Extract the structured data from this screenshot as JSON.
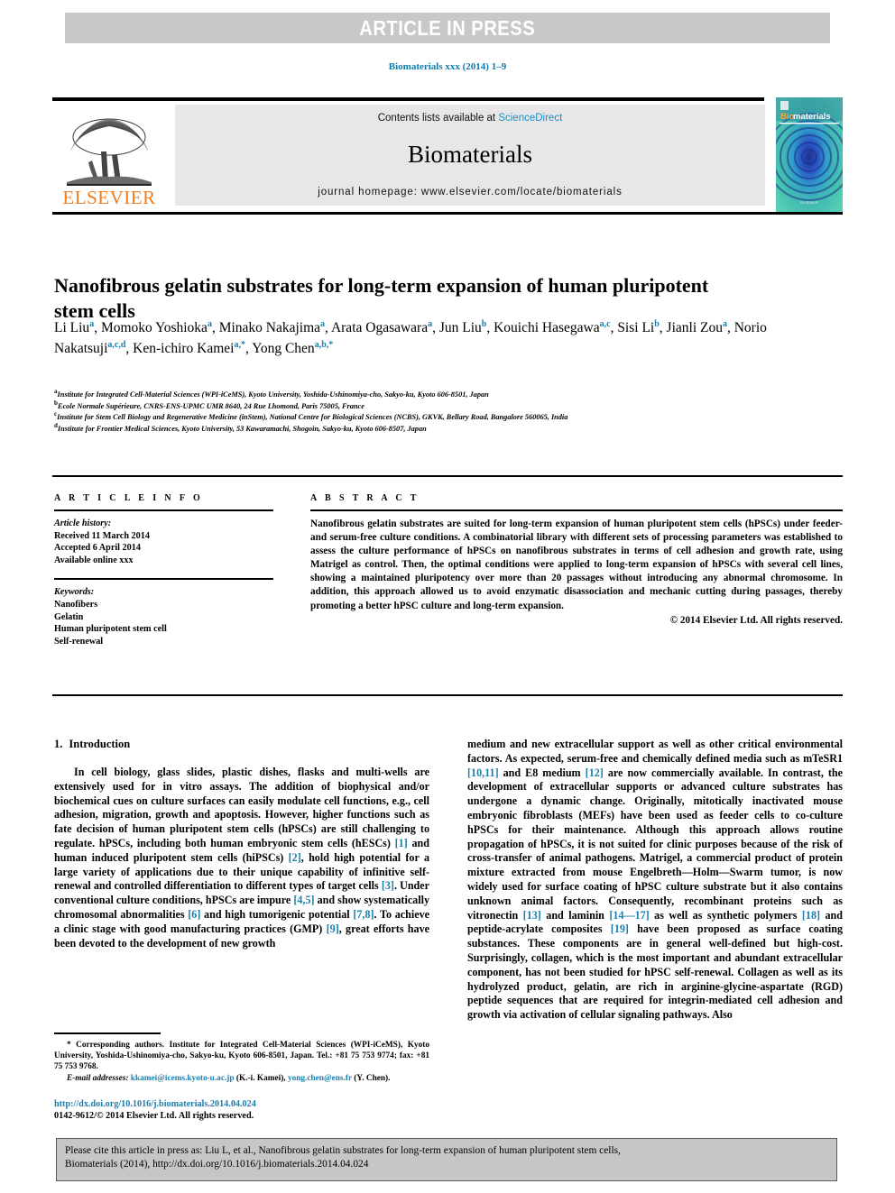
{
  "banner": {
    "text": "ARTICLE IN PRESS"
  },
  "journal_ref": "Biomaterials xxx (2014) 1–9",
  "header": {
    "contents_prefix": "Contents lists available at ",
    "contents_link": "ScienceDirect",
    "journal_title": "Biomaterials",
    "homepage": "journal homepage: www.elsevier.com/locate/biomaterials",
    "publisher_logo": "elsevier-tree-logo",
    "publisher_name": "ELSEVIER",
    "cover_label": "Biomaterials",
    "accent_link_color": "#1a8fc4",
    "elsevier_orange": "#f07d20",
    "banner_gray": "#c8c8c8"
  },
  "article": {
    "title": "Nanofibrous gelatin substrates for long-term expansion of human pluripotent stem cells",
    "authors": [
      {
        "name": "Li Liu",
        "sup": "a",
        "sep": ", "
      },
      {
        "name": "Momoko Yoshioka",
        "sup": "a",
        "sep": ", "
      },
      {
        "name": "Minako Nakajima",
        "sup": "a",
        "sep": ", "
      },
      {
        "name": "Arata Ogasawara",
        "sup": "a",
        "sep": ", "
      },
      {
        "name": "Jun Liu",
        "sup": "b",
        "sep": ", "
      },
      {
        "name": "Kouichi Hasegawa",
        "sup": "a,c",
        "sep": ", "
      },
      {
        "name": "Sisi Li",
        "sup": "b",
        "sep": ", "
      },
      {
        "name": "Jianli Zou",
        "sup": "a",
        "sep": ", "
      },
      {
        "name": "Norio Nakatsuji",
        "sup": "a,c,d",
        "sep": ", "
      },
      {
        "name": "Ken-ichiro Kamei",
        "sup": "a,*",
        "sep": ", "
      },
      {
        "name": "Yong Chen",
        "sup": "a,b,*",
        "sep": ""
      }
    ],
    "affiliations": [
      {
        "mark": "a",
        "text": "Institute for Integrated Cell-Material Sciences (WPI-iCeMS), Kyoto University, Yoshida-Ushinomiya-cho, Sakyo-ku, Kyoto 606-8501, Japan"
      },
      {
        "mark": "b",
        "text": "Ecole Normale Supérieure, CNRS-ENS-UPMC UMR 8640, 24 Rue Lhomond, Paris 75005, France"
      },
      {
        "mark": "c",
        "text": "Institute for Stem Cell Biology and Regenerative Medicine (inStem), National Centre for Biological Sciences (NCBS), GKVK, Bellary Road, Bangalore 560065, India"
      },
      {
        "mark": "d",
        "text": "Institute for Frontier Medical Sciences, Kyoto University, 53 Kawaramachi, Shogoin, Sakyo-ku, Kyoto 606-8507, Japan"
      }
    ]
  },
  "article_info": {
    "heading": "A R T I C L E  I N F O",
    "history_label": "Article history:",
    "history": [
      "Received 11 March 2014",
      "Accepted 6 April 2014",
      "Available online xxx"
    ],
    "keywords_label": "Keywords:",
    "keywords": [
      "Nanofibers",
      "Gelatin",
      "Human pluripotent stem cell",
      "Self-renewal"
    ]
  },
  "abstract": {
    "heading": "A B S T R A C T",
    "body": "Nanofibrous gelatin substrates are suited for long-term expansion of human pluripotent stem cells (hPSCs) under feeder- and serum-free culture conditions. A combinatorial library with different sets of processing parameters was established to assess the culture performance of hPSCs on nanofibrous substrates in terms of cell adhesion and growth rate, using Matrigel as control. Then, the optimal conditions were applied to long-term expansion of hPSCs with several cell lines, showing a maintained pluripotency over more than 20 passages without introducing any abnormal chromosome. In addition, this approach allowed us to avoid enzymatic disassociation and mechanic cutting during passages, thereby promoting a better hPSC culture and long-term expansion.",
    "copyright": "© 2014 Elsevier Ltd. All rights reserved."
  },
  "body": {
    "section_number": "1.",
    "section_title": "Introduction",
    "left_paragraph_parts": [
      {
        "t": "In cell biology, glass slides, plastic dishes, flasks and multi-wells are extensively used for in vitro assays. The addition of biophysical and/or biochemical cues on culture surfaces can easily modulate cell functions, e.g., cell adhesion, migration, growth and apoptosis. However, higher functions such as fate decision of human pluripotent stem cells (hPSCs) are still challenging to regulate. hPSCs, including both human embryonic stem cells (hESCs) ",
        "r": false
      },
      {
        "t": "[1]",
        "r": true
      },
      {
        "t": " and human induced pluripotent stem cells (hiPSCs) ",
        "r": false
      },
      {
        "t": "[2]",
        "r": true
      },
      {
        "t": ", hold high potential for a large variety of applications due to their unique capability of infinitive self-renewal and controlled differentiation to different types of target cells ",
        "r": false
      },
      {
        "t": "[3]",
        "r": true
      },
      {
        "t": ". Under conventional culture conditions, hPSCs are impure ",
        "r": false
      },
      {
        "t": "[4,5]",
        "r": true
      },
      {
        "t": " and show systematically chromosomal abnormalities ",
        "r": false
      },
      {
        "t": "[6]",
        "r": true
      },
      {
        "t": " and high tumorigenic potential ",
        "r": false
      },
      {
        "t": "[7,8]",
        "r": true
      },
      {
        "t": ". To achieve a clinic stage with good manufacturing practices (GMP) ",
        "r": false
      },
      {
        "t": "[9]",
        "r": true
      },
      {
        "t": ", great efforts have been devoted to the development of new growth",
        "r": false
      }
    ],
    "right_paragraph_parts": [
      {
        "t": "medium and new extracellular support as well as other critical environmental factors. As expected, serum-free and chemically defined media such as mTeSR1 ",
        "r": false
      },
      {
        "t": "[10,11]",
        "r": true
      },
      {
        "t": " and E8 medium ",
        "r": false
      },
      {
        "t": "[12]",
        "r": true
      },
      {
        "t": " are now commercially available. In contrast, the development of extracellular supports or advanced culture substrates has undergone a dynamic change. Originally, mitotically inactivated mouse embryonic fibroblasts (MEFs) have been used as feeder cells to co-culture hPSCs for their maintenance. Although this approach allows routine propagation of hPSCs, it is not suited for clinic purposes because of the risk of cross-transfer of animal pathogens. Matrigel, a commercial product of protein mixture extracted from mouse Engelbreth—Holm—Swarm tumor, is now widely used for surface coating of hPSC culture substrate but it also contains unknown animal factors. Consequently, recombinant proteins such as vitronectin ",
        "r": false
      },
      {
        "t": "[13]",
        "r": true
      },
      {
        "t": " and laminin ",
        "r": false
      },
      {
        "t": "[14—17]",
        "r": true
      },
      {
        "t": " as well as synthetic polymers ",
        "r": false
      },
      {
        "t": "[18]",
        "r": true
      },
      {
        "t": " and peptide-acrylate composites ",
        "r": false
      },
      {
        "t": "[19]",
        "r": true
      },
      {
        "t": " have been proposed as surface coating substances. These components are in general well-defined but high-cost. Surprisingly, collagen, which is the most important and abundant extracellular component, has not been studied for hPSC self-renewal. Collagen as well as its hydrolyzed product, gelatin, are rich in arginine-glycine-aspartate (RGD) peptide sequences that are required for integrin-mediated cell adhesion and growth via activation of cellular signaling pathways. Also",
        "r": false
      }
    ]
  },
  "footnote": {
    "corresponding": "* Corresponding authors. Institute for Integrated Cell-Material Sciences (WPI-iCeMS), Kyoto University, Yoshida-Ushinomiya-cho, Sakyo-ku, Kyoto 606-8501, Japan. Tel.: +81 75 753 9774; fax: +81 75 753 9768.",
    "email_label": "E-mail addresses:",
    "email1": "kkamei@icems.kyoto-u.ac.jp",
    "email1_owner": "(K.-i. Kamei),",
    "email2": "yong.chen@ens.fr",
    "email2_owner": "(Y. Chen).",
    "doi_url": "http://dx.doi.org/10.1016/j.biomaterials.2014.04.024",
    "issn_line": "0142-9612/© 2014 Elsevier Ltd. All rights reserved."
  },
  "cite_box": {
    "line1": "Please cite this article in press as: Liu L, et al., Nanofibrous gelatin substrates for long-term expansion of human pluripotent stem cells,",
    "line2": "Biomaterials (2014), http://dx.doi.org/10.1016/j.biomaterials.2014.04.024"
  }
}
